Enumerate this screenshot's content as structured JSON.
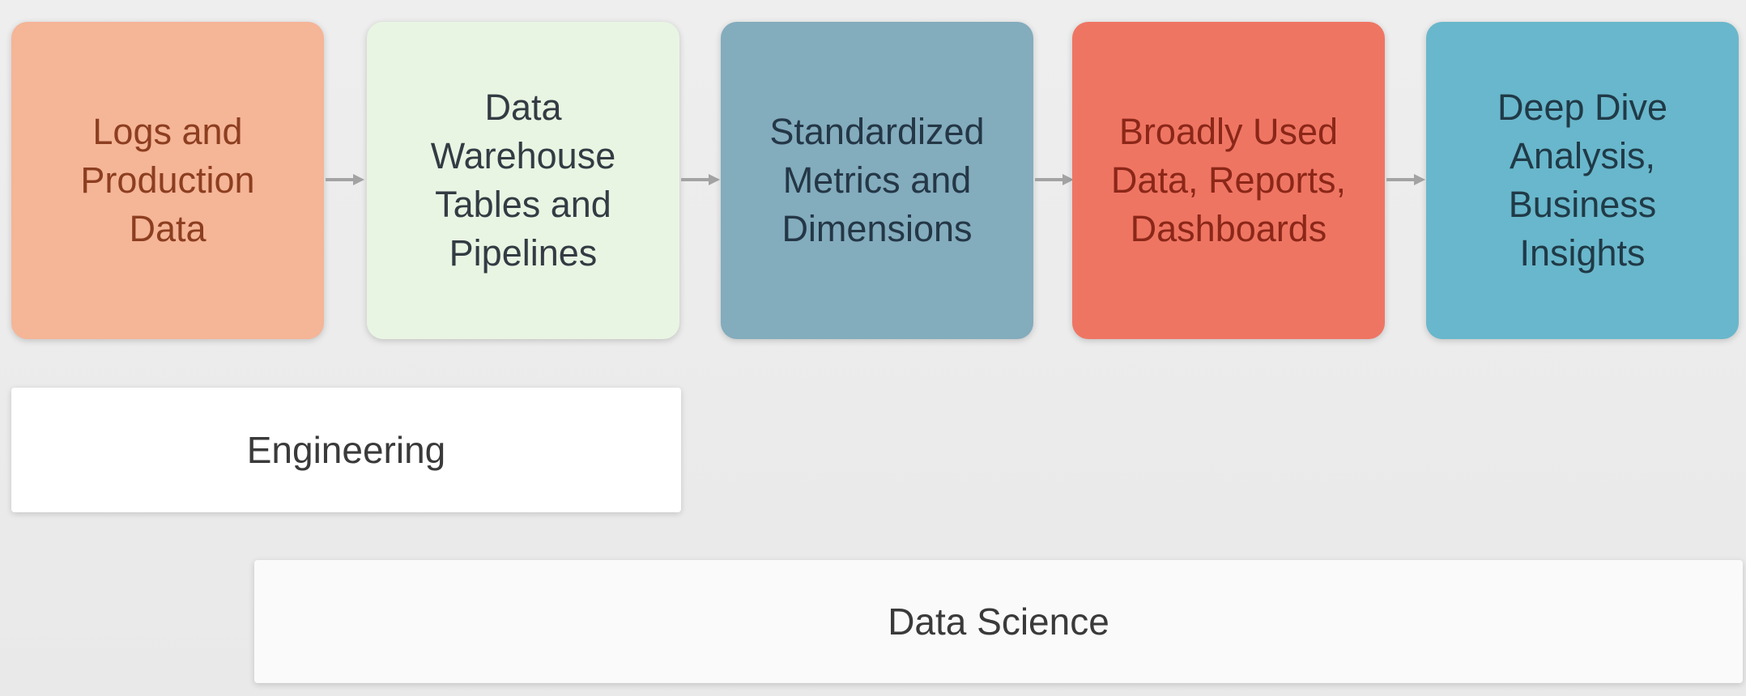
{
  "diagram": {
    "stages": [
      {
        "label": "Logs and\nProduction\nData",
        "color": "#f5b597"
      },
      {
        "label": "Data\nWarehouse\nTables and\nPipelines",
        "color": "#e9f5e3"
      },
      {
        "label": "Standardized\nMetrics and\nDimensions",
        "color": "#83acbd"
      },
      {
        "label": "Broadly Used\nData, Reports,\nDashboards",
        "color": "#ef7563"
      },
      {
        "label": "Deep Dive\nAnalysis,\nBusiness\nInsights",
        "color": "#69b7cc"
      }
    ],
    "teams": {
      "engineering": "Engineering",
      "data_science": "Data Science"
    },
    "arrow_color": "#a3a3a3"
  }
}
